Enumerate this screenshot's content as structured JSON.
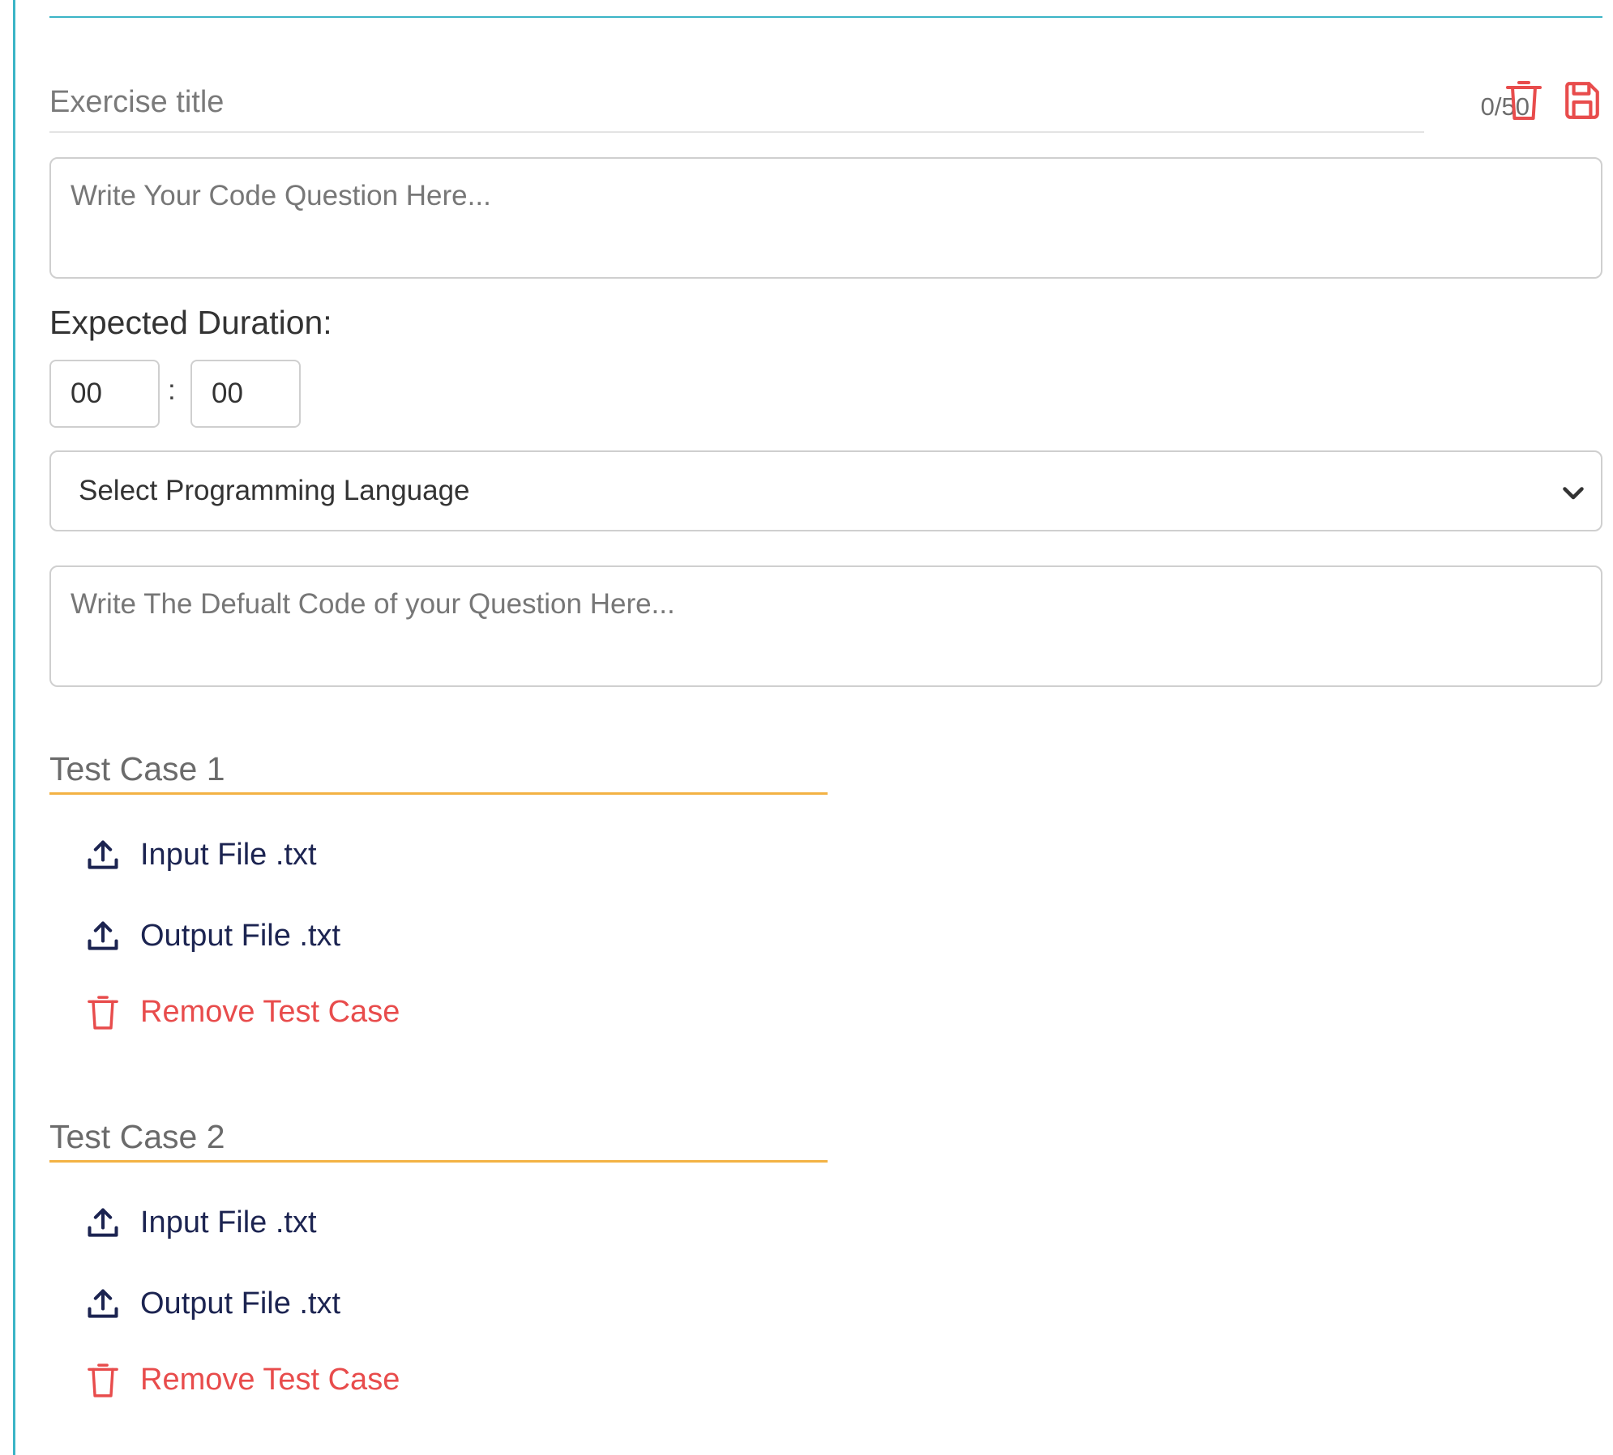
{
  "exercise": {
    "title_placeholder": "Exercise title",
    "char_count": "0/50",
    "delete_icon": "trash-icon",
    "save_icon": "save-icon"
  },
  "question": {
    "placeholder": "Write Your Code Question Here..."
  },
  "duration": {
    "label": "Expected Duration:",
    "hours": "00",
    "separator": ":",
    "minutes": "00"
  },
  "language": {
    "selected": "Select Programming Language",
    "icon": "chevron-down-icon"
  },
  "default_code": {
    "placeholder": "Write The Defualt Code of your Question Here..."
  },
  "test_cases": [
    {
      "title": "Test Case 1",
      "input_label": "Input File .txt",
      "output_label": "Output File .txt",
      "remove_label": "Remove Test Case"
    },
    {
      "title": "Test Case 2",
      "input_label": "Input File .txt",
      "output_label": "Output File .txt",
      "remove_label": "Remove Test Case"
    }
  ],
  "colors": {
    "accent_teal": "#3bb4c6",
    "danger_red": "#e84c4c",
    "underline_orange": "#f3b244",
    "upload_navy": "#1c2451"
  }
}
